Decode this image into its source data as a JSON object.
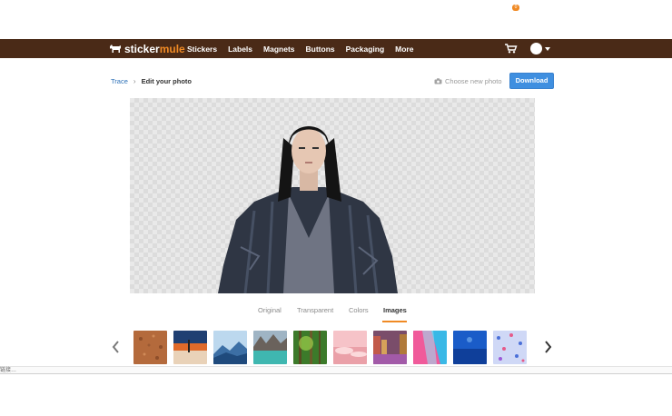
{
  "brand": {
    "part1": "sticker",
    "part2": "mule"
  },
  "nav": {
    "items": [
      "Stickers",
      "Labels",
      "Magnets",
      "Buttons",
      "Packaging",
      "More"
    ]
  },
  "cart": {
    "count": "0"
  },
  "breadcrumb": {
    "parent": "Trace",
    "separator": "›",
    "current": "Edit your photo"
  },
  "actions": {
    "choose_label": "Choose new photo",
    "download_label": "Download"
  },
  "tabs": {
    "items": [
      "Original",
      "Transparent",
      "Colors",
      "Images"
    ],
    "active": "Images"
  },
  "thumbnails": [
    "cork-texture",
    "desert-sunset",
    "blue-mountains",
    "lake-rocks",
    "green-forest",
    "pink-clouds",
    "city-canal",
    "pink-blue-abstract",
    "underwater-blue",
    "blue-pink-confetti"
  ],
  "colors": {
    "topbar": "#4a2a17",
    "accent": "#f08a24",
    "link": "#2b6fb6",
    "download": "#3f8fe0"
  },
  "status": {
    "text": "链接…"
  },
  "icons": [
    "mule-logo-icon",
    "cart-icon",
    "avatar",
    "camera-icon",
    "chevron-left-icon",
    "chevron-right-icon"
  ]
}
